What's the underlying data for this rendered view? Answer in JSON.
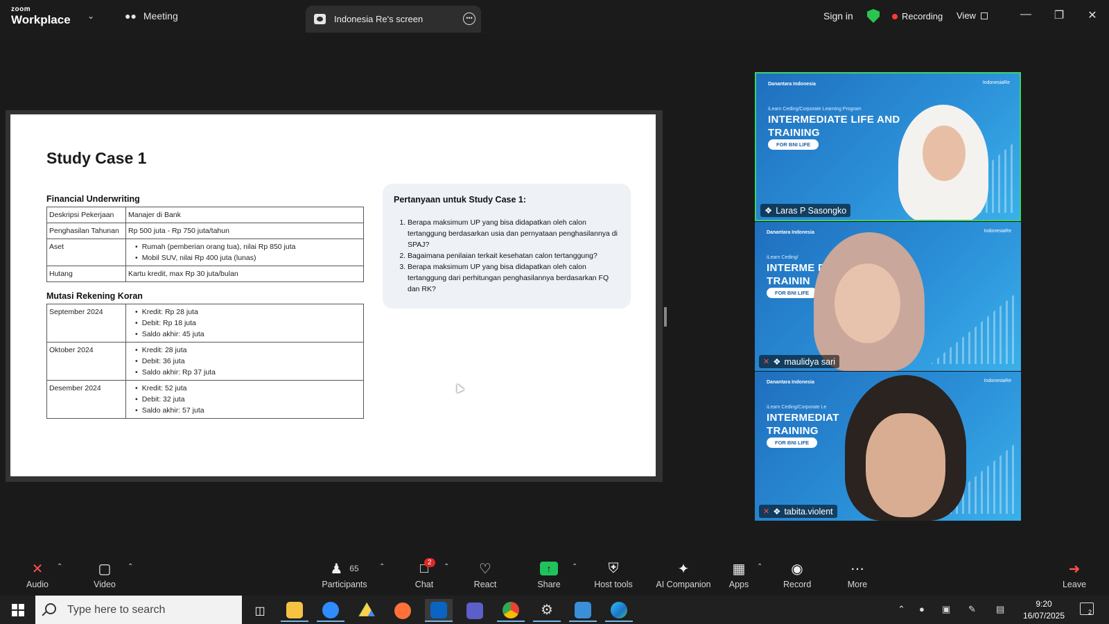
{
  "titlebar": {
    "brand_top": "zoom",
    "brand_bottom": "Workplace",
    "meeting_label": "Meeting",
    "tab_label": "Indonesia Re's screen",
    "signin_label": "Sign in",
    "recording_label": "Recording",
    "view_label": "View"
  },
  "slide": {
    "title": "Study Case 1",
    "financial_heading": "Financial Underwriting",
    "financial_rows": [
      {
        "label": "Deskripsi Pekerjaan",
        "value": "Manajer di Bank"
      },
      {
        "label": "Penghasilan Tahunan",
        "value": "Rp 500 juta - Rp 750 juta/tahun"
      },
      {
        "label": "Aset",
        "items": [
          "Rumah (pemberian orang tua), nilai Rp 850 juta",
          "Mobil SUV, nilai Rp 400 juta (lunas)"
        ]
      },
      {
        "label": "Hutang",
        "value": "Kartu kredit, max Rp 30 juta/bulan"
      }
    ],
    "mutasi_heading": "Mutasi Rekening Koran",
    "mutasi_rows": [
      {
        "month": "September 2024",
        "items": [
          "Kredit: Rp 28 juta",
          "Debit: Rp 18 juta",
          "Saldo akhir: 45 juta"
        ]
      },
      {
        "month": "Oktober 2024",
        "items": [
          "Kredit: 28 juta",
          "Debit: 36 juta",
          "Saldo akhir: Rp 37 juta"
        ]
      },
      {
        "month": "Desember 2024",
        "items": [
          "Kredit: 52 juta",
          "Debit: 32 juta",
          "Saldo akhir: 57 juta"
        ]
      }
    ],
    "questions_title": "Pertanyaan untuk Study Case 1:",
    "questions": [
      "Berapa maksimum UP yang bisa didapatkan oleh calon tertanggung berdasarkan usia dan pernyataan penghasilannya di SPAJ?",
      "Bagaimana penilaian terkait kesehatan calon tertanggung?",
      "Berapa maksimum UP yang bisa didapatkan oleh calon tertanggung dari perhitungan penghasilannya berdasarkan FQ dan RK?"
    ]
  },
  "videos": [
    {
      "name": "Laras P Sasongko",
      "heading_line1": "INTERMEDIATE LIFE AND",
      "heading_line2": "TRAINING",
      "pill": "FOR BNI LIFE",
      "program": "iLearn Ceding/Corporate Learning Program",
      "logo": "Danantara Indonesia",
      "logo2": "IndonesiaRe",
      "muted": false
    },
    {
      "name": "maulidya sari",
      "heading_line1": "INTERME          D HEALTH",
      "heading_line2": "TRAININ",
      "pill": "FOR BNI LIFE",
      "program": "iLearn Ceding/",
      "logo": "Danantara Indonesia",
      "logo2": "IndonesiaRe",
      "muted": true
    },
    {
      "name": "tabita.violent",
      "heading_line1": "INTERMEDIAT",
      "heading_line2": "TRAINING",
      "pill": "FOR BNI LIFE",
      "program": "iLearn Ceding/Corporate Le",
      "logo": "Danantara Indonesia",
      "logo2": "IndonesiaRe",
      "muted": true
    }
  ],
  "toolbar": {
    "audio": "Audio",
    "video": "Video",
    "participants": "Participants",
    "participants_count": "65",
    "chat": "Chat",
    "chat_badge": "2",
    "react": "React",
    "share": "Share",
    "host_tools": "Host tools",
    "ai_companion": "AI Companion",
    "apps": "Apps",
    "record": "Record",
    "more": "More",
    "leave": "Leave"
  },
  "taskbar": {
    "search_placeholder": "Type here to search",
    "time": "9:20",
    "date": "16/07/2025",
    "notif_count": "2"
  }
}
